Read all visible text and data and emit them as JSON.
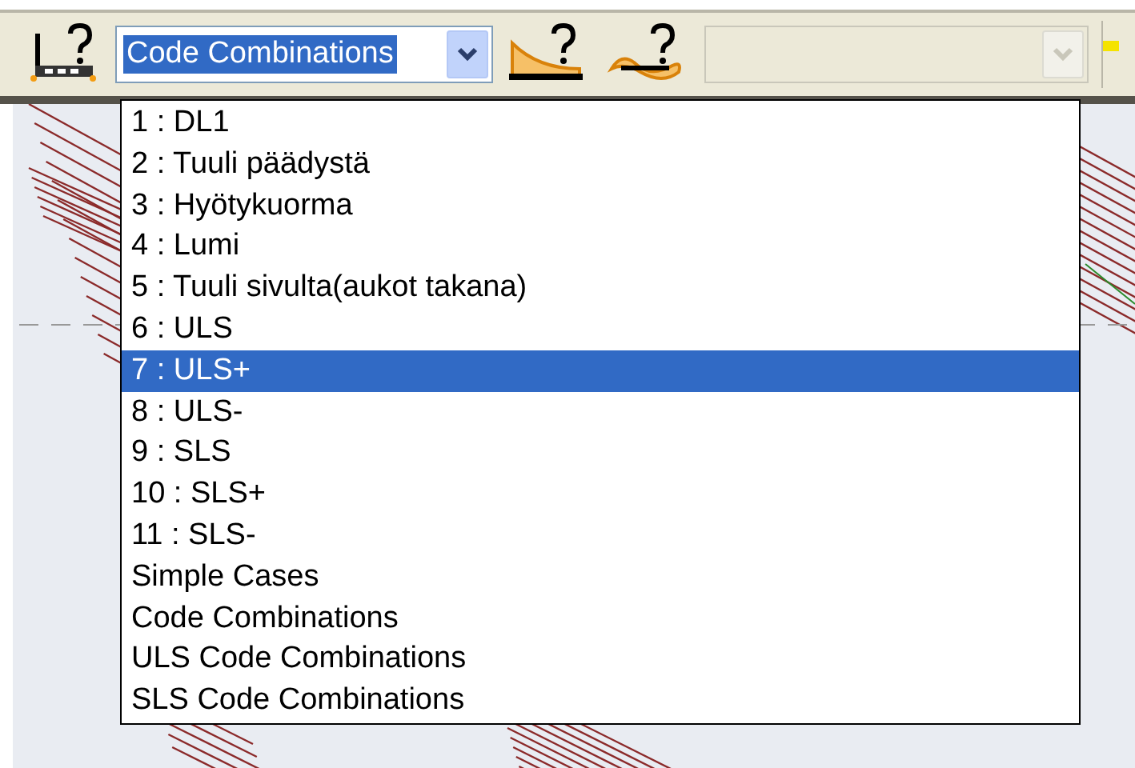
{
  "toolbar": {
    "load_combo": {
      "value": "Code Combinations",
      "selected": true
    },
    "second_combo": {
      "disabled": true
    }
  },
  "dropdown": {
    "items": [
      {
        "label": "1 : DL1",
        "selected": false
      },
      {
        "label": "2 : Tuuli päädystä",
        "selected": false
      },
      {
        "label": "3 : Hyötykuorma",
        "selected": false
      },
      {
        "label": "4 : Lumi",
        "selected": false
      },
      {
        "label": "5 : Tuuli sivulta(aukot takana)",
        "selected": false
      },
      {
        "label": "6 : ULS",
        "selected": false
      },
      {
        "label": "7 : ULS+",
        "selected": true
      },
      {
        "label": "8 : ULS-",
        "selected": false
      },
      {
        "label": "9 : SLS",
        "selected": false
      },
      {
        "label": "10 : SLS+",
        "selected": false
      },
      {
        "label": "11 : SLS-",
        "selected": false
      },
      {
        "label": "Simple Cases",
        "selected": false
      },
      {
        "label": "Code Combinations",
        "selected": false
      },
      {
        "label": "ULS Code Combinations",
        "selected": false
      },
      {
        "label": "SLS Code Combinations",
        "selected": false
      }
    ]
  }
}
